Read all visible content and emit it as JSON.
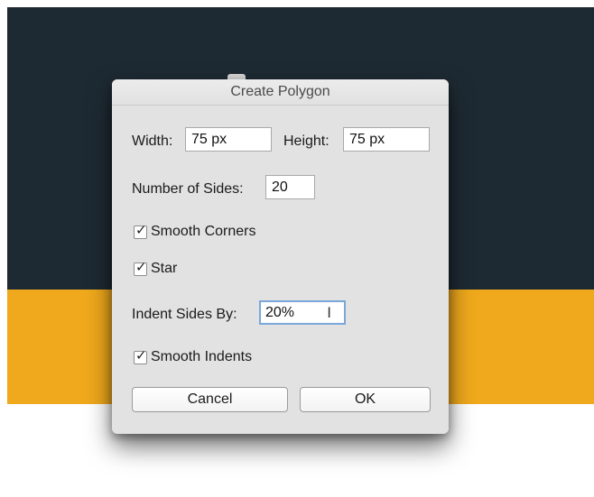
{
  "dialog": {
    "title": "Create Polygon",
    "width_label": "Width:",
    "width_value": "75 px",
    "height_label": "Height:",
    "height_value": "75 px",
    "sides_label": "Number of Sides:",
    "sides_value": "20",
    "smooth_corners_label": "Smooth Corners",
    "smooth_corners_checked": true,
    "star_label": "Star",
    "star_checked": true,
    "indent_label": "Indent Sides By:",
    "indent_value": "20%",
    "smooth_indents_label": "Smooth Indents",
    "smooth_indents_checked": true,
    "cancel_label": "Cancel",
    "ok_label": "OK"
  },
  "background_colors": {
    "dark": "#1e2a33",
    "accent": "#f0a91c",
    "light": "#ffffff"
  }
}
